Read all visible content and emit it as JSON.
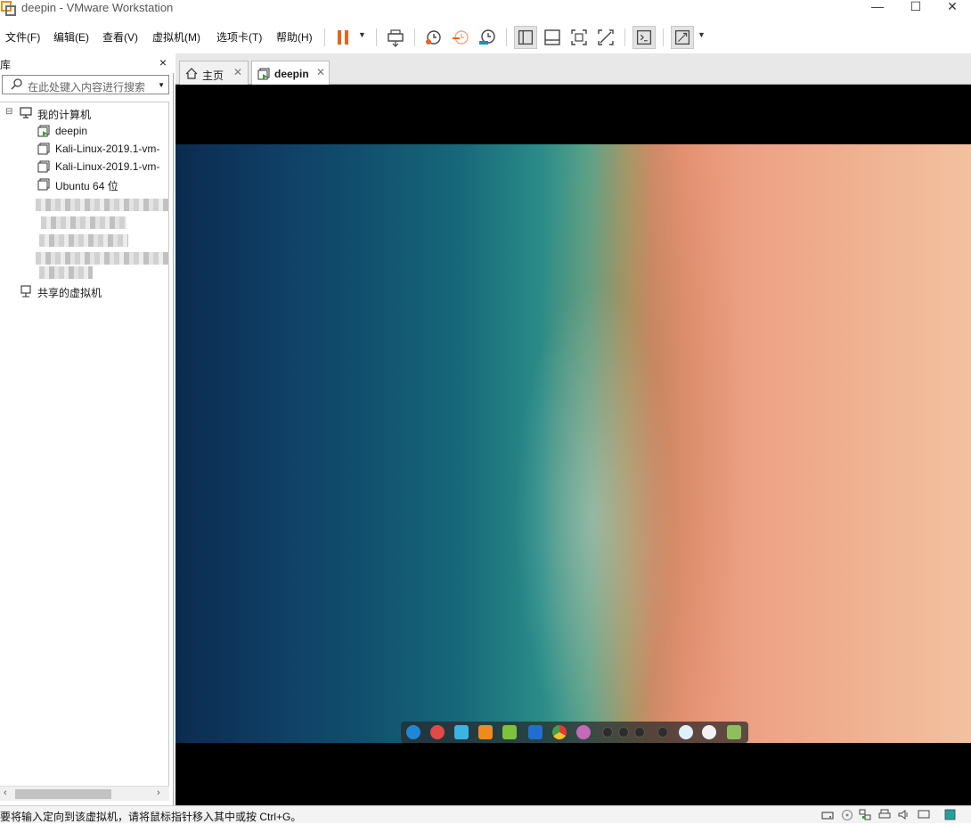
{
  "window": {
    "title": "deepin - VMware Workstation",
    "minimize": "—",
    "maximize": "☐",
    "close": "✕"
  },
  "menu": {
    "file": "文件(F)",
    "edit": "编辑(E)",
    "view": "查看(V)",
    "vm": "虚拟机(M)",
    "tabs": "选项卡(T)",
    "help": "帮助(H)"
  },
  "toolbar": {
    "icons": [
      "pause-icon",
      "send-ctrl-alt-del-icon",
      "snapshot-take-icon",
      "snapshot-revert-icon",
      "snapshot-manager-icon",
      "library-view-icon",
      "thumbnail-bar-icon",
      "full-screen-icon",
      "unity-icon",
      "console-view-icon",
      "stretch-guest-icon"
    ],
    "pause_color": "#e8651e"
  },
  "library": {
    "title": "库",
    "close": "×",
    "search_placeholder": "在此处键入内容进行搜索",
    "tree": {
      "expander": "⊟",
      "root": "我的计算机",
      "vms": [
        "deepin",
        "Kali-Linux-2019.1-vm-",
        "Kali-Linux-2019.1-vm-",
        "Ubuntu 64 位"
      ],
      "shared": "共享的虚拟机"
    }
  },
  "tabs": [
    {
      "label": "主页",
      "close": "✕",
      "icon": "home-icon"
    },
    {
      "label": "deepin",
      "close": "✕",
      "icon": "vm-running-icon"
    }
  ],
  "dock": {
    "items": [
      "launcher-icon",
      "screen-recorder-icon",
      "file-manager-icon",
      "app-store-icon",
      "music-icon",
      "video-icon",
      "chrome-icon",
      "settings-icon"
    ],
    "tray": [
      "keyboard-icon",
      "volume-icon",
      "edit-icon",
      "arrow-left-icon",
      "power-icon",
      "clock-icon",
      "trash-icon"
    ]
  },
  "status": {
    "text": "要将输入定向到该虚拟机，请将鼠标指针移入其中或按 Ctrl+G。",
    "icons": [
      "hard-disk-icon",
      "cd-icon",
      "network-icon",
      "printer-icon",
      "sound-icon",
      "display-icon",
      "message-icon"
    ]
  }
}
